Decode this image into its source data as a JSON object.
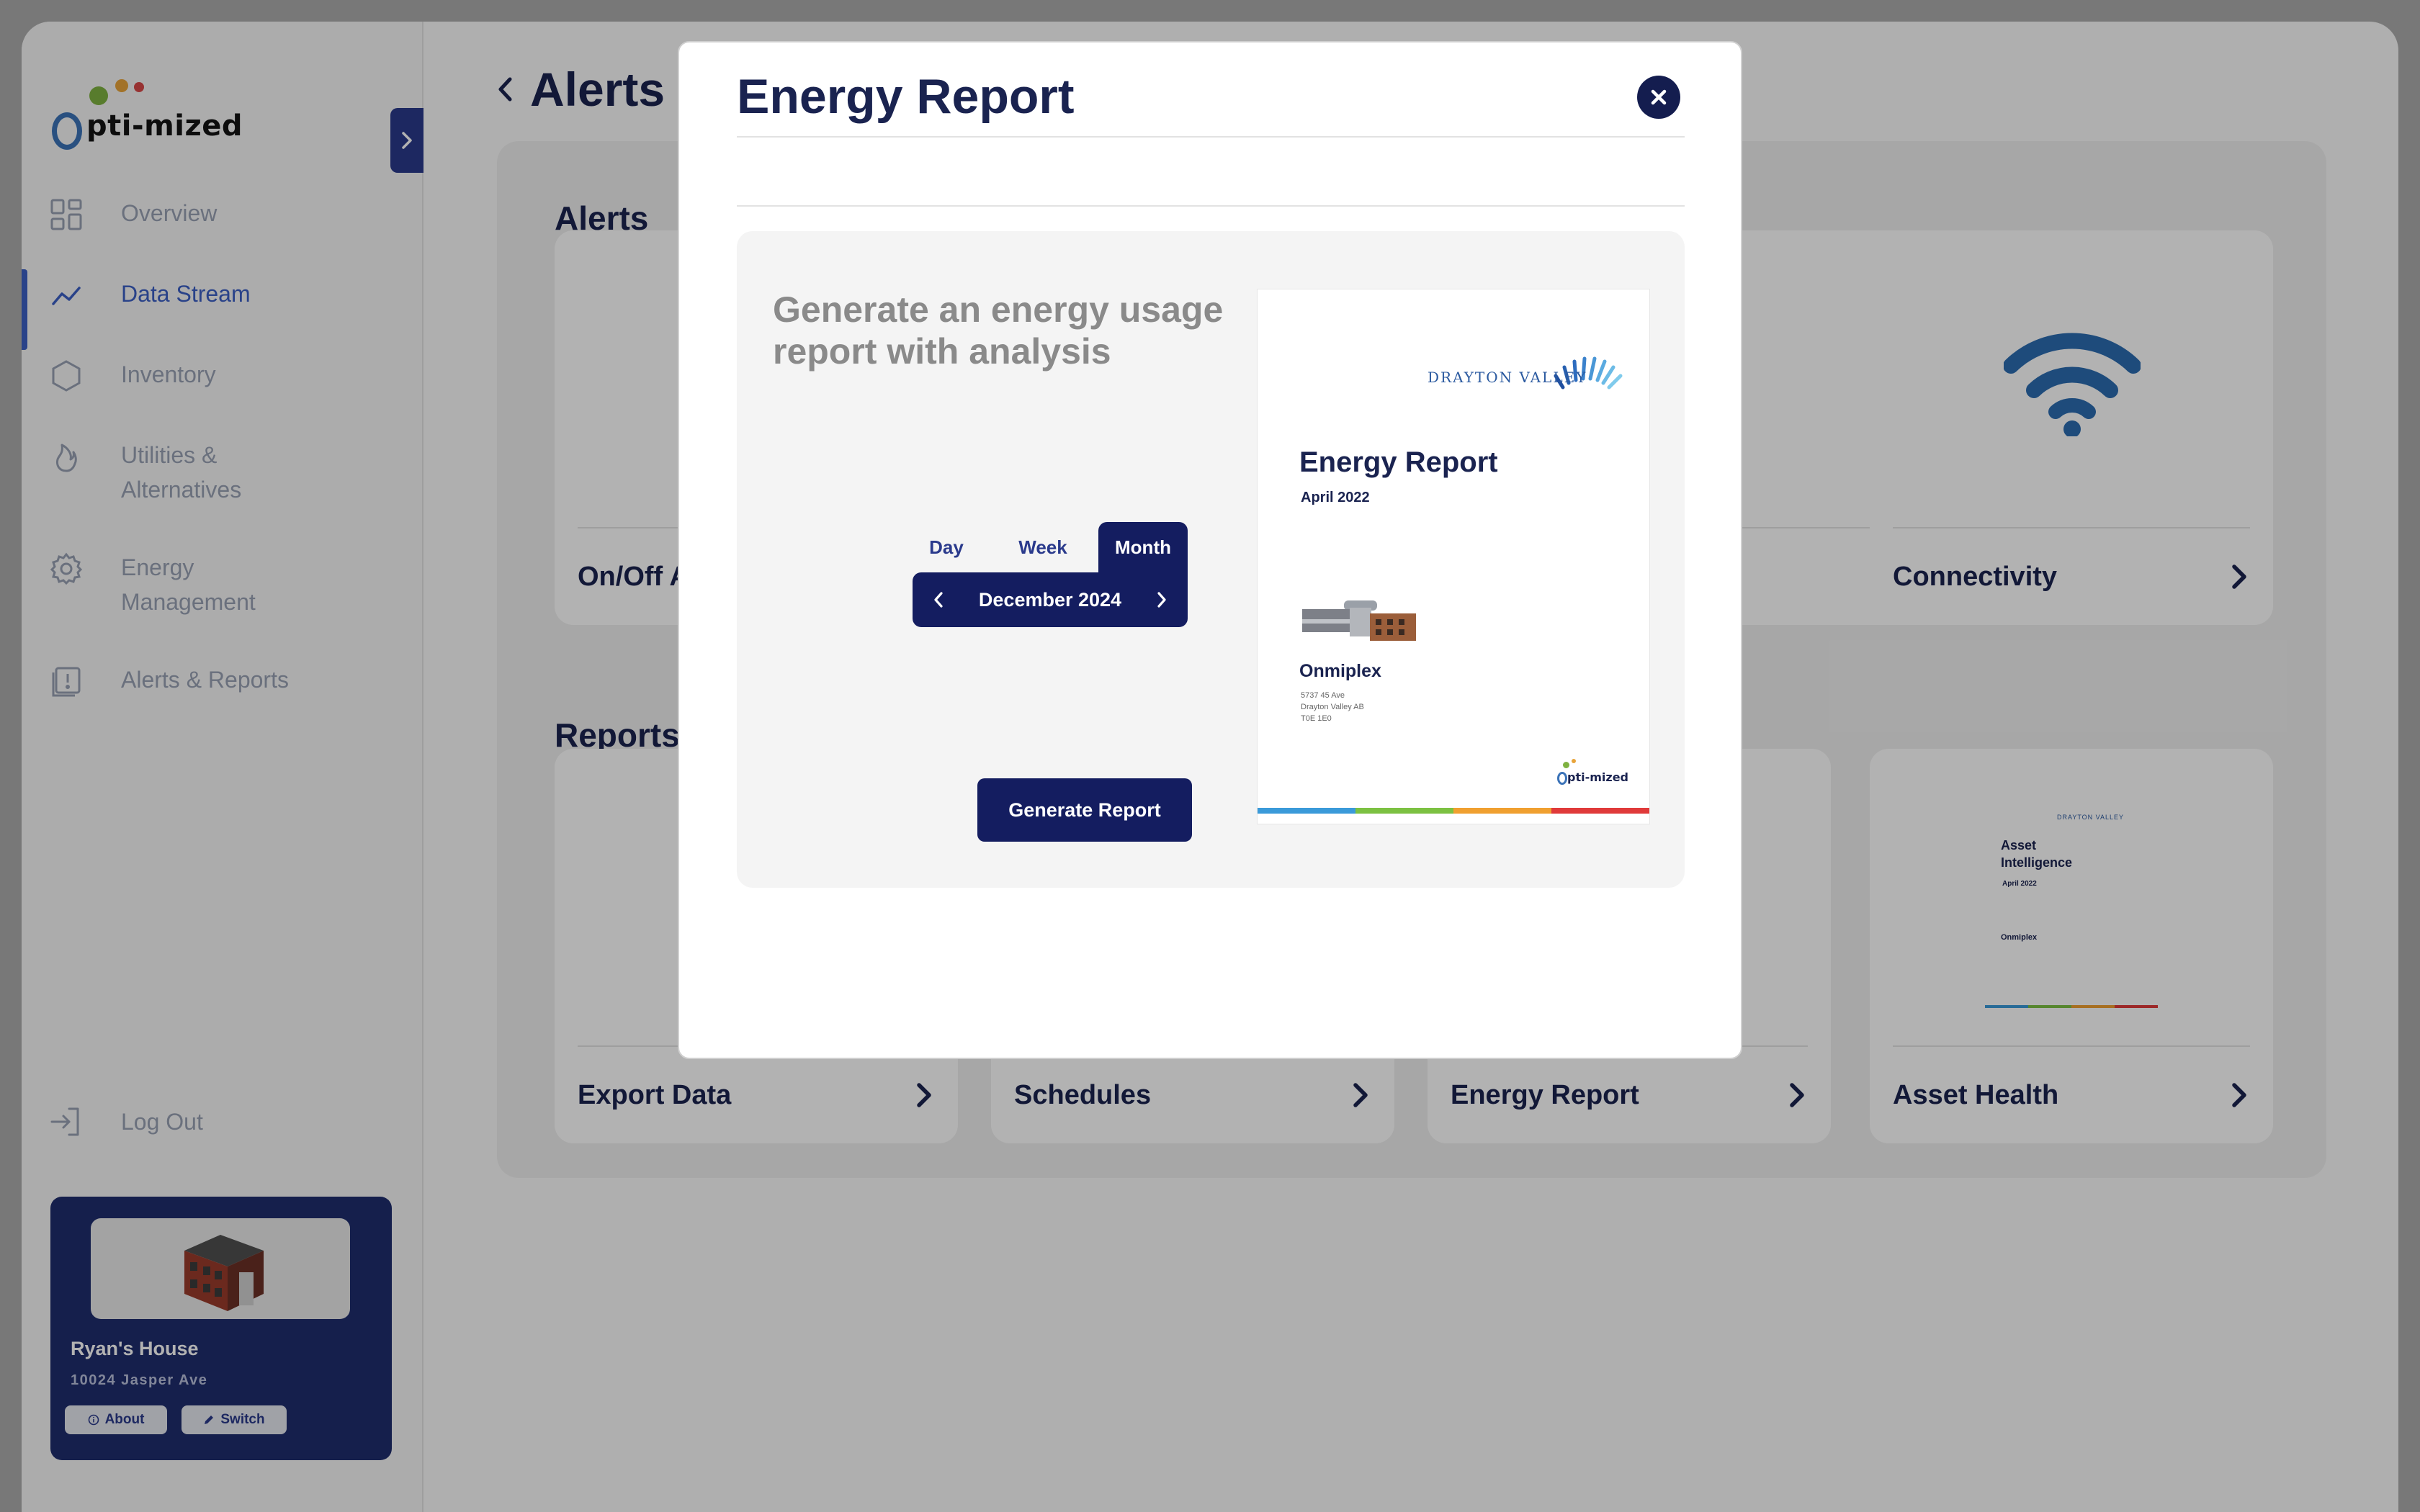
{
  "app": {
    "logo_text": "pti-mized",
    "collapse_icon": "chevron-right-icon"
  },
  "sidebar": {
    "items": [
      {
        "label": "Overview",
        "icon": "grid-icon",
        "active": false
      },
      {
        "label": "Data Stream",
        "icon": "trend-line-icon",
        "active": true
      },
      {
        "label": "Inventory",
        "icon": "hexagon-icon",
        "active": false
      },
      {
        "label": "Utilities &\nAlternatives",
        "icon": "flame-icon",
        "active": false
      },
      {
        "label": "Energy\nManagement",
        "icon": "gear-icon",
        "active": false
      },
      {
        "label": "Alerts & Reports",
        "icon": "report-alert-icon",
        "active": false
      }
    ],
    "logout_label": "Log Out",
    "house": {
      "name": "Ryan's House",
      "address": "10024 Jasper Ave",
      "about_label": "About",
      "switch_label": "Switch"
    }
  },
  "main": {
    "title": "Alerts &",
    "alerts_heading": "Alerts",
    "reports_heading": "Reports",
    "alert_tiles": [
      {
        "label": "On/Off A"
      },
      {
        "label": ""
      },
      {
        "label": ""
      },
      {
        "label": "Connectivity"
      }
    ],
    "report_tiles": [
      {
        "label": "Export Data"
      },
      {
        "label": "Schedules"
      },
      {
        "label": "Energy Report"
      },
      {
        "label": "Asset Health"
      }
    ],
    "asset_preview": {
      "brand": "DRAYTON VALLEY",
      "title": "Asset Intelligence",
      "date": "April 2022",
      "site": "Onmiplex"
    }
  },
  "modal": {
    "title": "Energy Report",
    "heading": "Generate an energy usage report with analysis",
    "tabs": [
      "Day",
      "Week",
      "Month"
    ],
    "active_tab": "Month",
    "period": "December 2024",
    "generate_label": "Generate Report",
    "preview": {
      "brand": "DRAYTON VALLEY",
      "title": "Energy Report",
      "date": "April 2022",
      "site": "Onmiplex",
      "address_lines": [
        "5737 45 Ave",
        "Drayton Valley AB",
        "T0E 1E0"
      ],
      "logo_text": "pti-mized"
    }
  },
  "colors": {
    "navy": "#141d60",
    "accent": "#3b5fc4",
    "wifi": "#2b6cb0",
    "stripe": [
      "#3a9ad9",
      "#7cc142",
      "#f0a030",
      "#e03a3a"
    ]
  }
}
